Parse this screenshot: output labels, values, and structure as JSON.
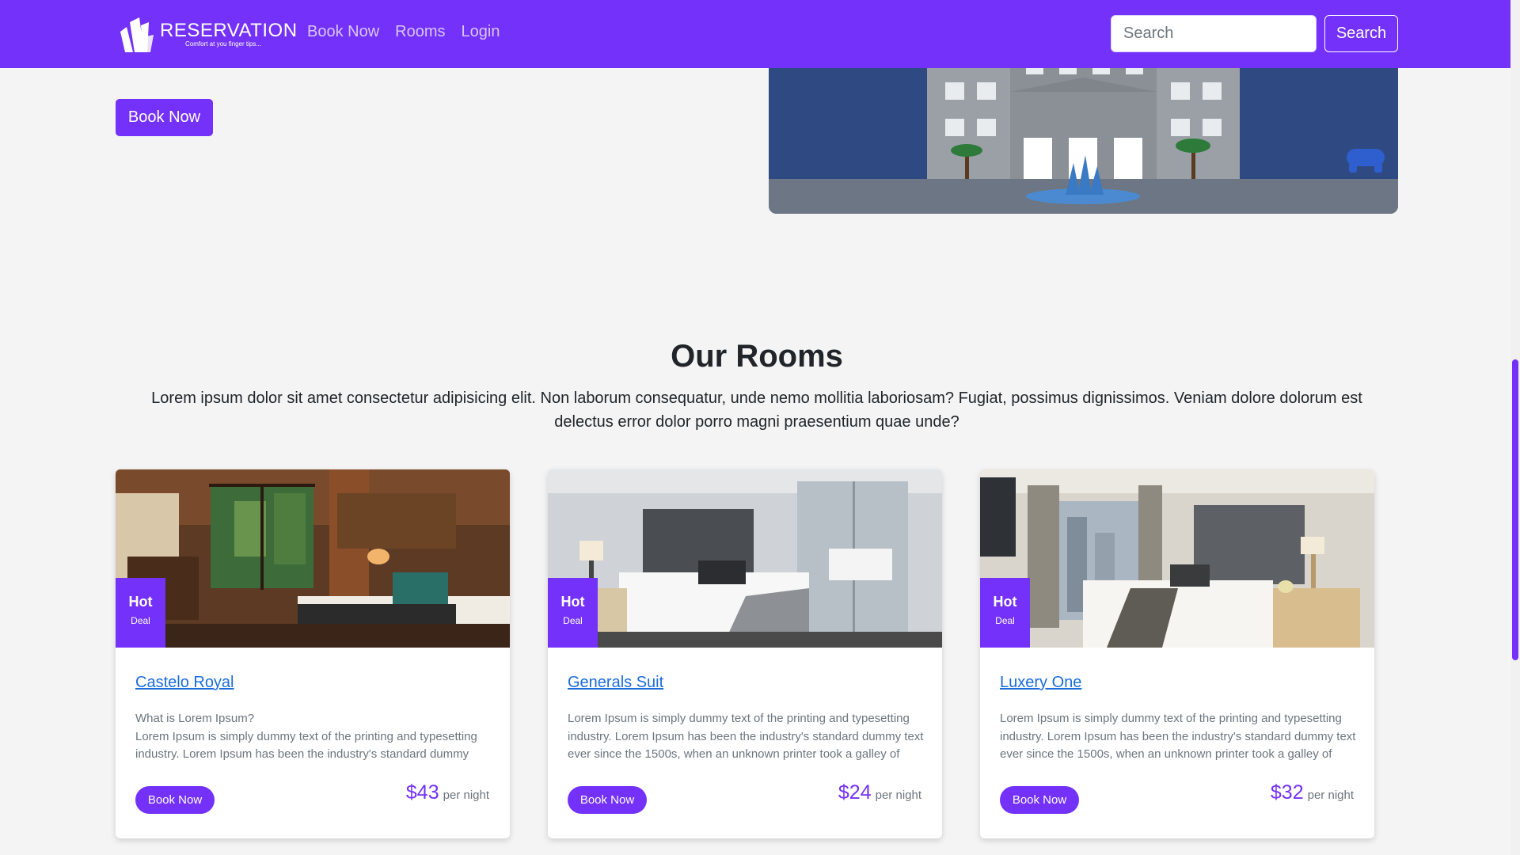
{
  "brand": {
    "name": "RESERVATION",
    "tagline": "Comfort at you finger tips..."
  },
  "nav": {
    "items": [
      {
        "label": "Book Now"
      },
      {
        "label": "Rooms"
      },
      {
        "label": "Login"
      }
    ]
  },
  "search": {
    "placeholder": "Search",
    "button_label": "Search"
  },
  "hero": {
    "book_label": "Book Now"
  },
  "rooms_section": {
    "title": "Our Rooms",
    "description": "Lorem ipsum dolor sit amet consectetur adipisicing elit. Non laborum consequatur, unde nemo mollitia laboriosam? Fugiat, possimus dignissimos. Veniam dolore dolorum est delectus error dolor porro magni praesentium quae unde?",
    "cards": [
      {
        "badge_hot": "Hot",
        "badge_deal": "Deal",
        "title": "Castelo Royal",
        "text": "What is Lorem Ipsum?\nLorem Ipsum is simply dummy text of the printing and typesetting industry. Lorem Ipsum has been the industry's standard dummy",
        "book_label": "Book Now",
        "price": "$43",
        "price_unit": "per night"
      },
      {
        "badge_hot": "Hot",
        "badge_deal": "Deal",
        "title": "Generals Suit",
        "text": "Lorem Ipsum is simply dummy text of the printing and typesetting industry. Lorem Ipsum has been the industry's standard dummy text ever since the 1500s, when an unknown printer took a galley of",
        "book_label": "Book Now",
        "price": "$24",
        "price_unit": "per night"
      },
      {
        "badge_hot": "Hot",
        "badge_deal": "Deal",
        "title": "Luxery One",
        "text": "Lorem Ipsum is simply dummy text of the printing and typesetting industry. Lorem Ipsum has been the industry's standard dummy text ever since the 1500s, when an unknown printer took a galley of",
        "book_label": "Book Now",
        "price": "$32",
        "price_unit": "per night"
      }
    ]
  },
  "colors": {
    "primary": "#7431f9",
    "link": "#1a6cdc",
    "background": "#f4f4f4"
  }
}
